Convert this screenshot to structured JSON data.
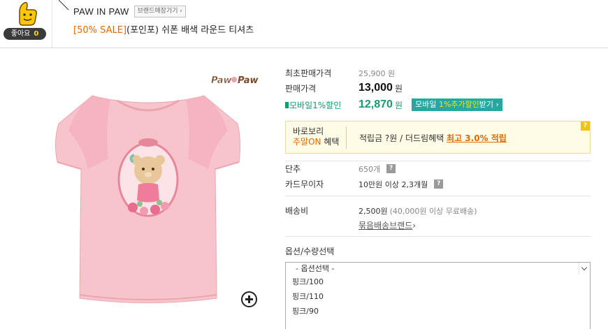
{
  "like": {
    "label": "좋아요",
    "count": "0"
  },
  "brand": {
    "name": "PAW IN PAW",
    "store_button": "브랜드매장가기 ›"
  },
  "product": {
    "sale_tag": "[50% SALE]",
    "title": "(포인포) 쉬폰 배색 라운드 티셔츠",
    "image_brand": "Paw Paw"
  },
  "price": {
    "lowest_label": "최초판매가격",
    "lowest_value": "25,900 원",
    "sale_label": "판매가격",
    "sale_value": "13,000",
    "won": "원",
    "mobile_label": "모바일1%할인",
    "mobile_value": "12,870",
    "mobile_button_prefix": "모바일 ",
    "mobile_button_highlight": "1%추가할인",
    "mobile_button_suffix": "받기 ›"
  },
  "points": {
    "line1": "바로보리",
    "line2_highlight": "주말ON",
    "line2_suffix": " 혜택",
    "desc": "적립금 ?원 / 더드림혜택 ",
    "max": "최고 3.0% 적립"
  },
  "details": {
    "button_label": "단추",
    "button_value": "650개",
    "card_label": "카드무이자",
    "card_value": "10만원 이상 2,3개월",
    "shipping_label": "배송비",
    "shipping_value": "2,500원",
    "shipping_note": "(40,000원 이상 무료배송)",
    "bundle_link": "묶음배송브랜드",
    "bundle_arrow": " ›"
  },
  "options": {
    "title": "옵션/수량선택",
    "selected": "- 옵션선택 -",
    "items": [
      "핑크/100",
      "핑크/110",
      "핑크/90"
    ]
  },
  "colors": {
    "accent_orange": "#e36a00",
    "mobile_green": "#1a9a6c",
    "mobile_btn": "#27a7a0",
    "shirt_pink": "#f8c4cb"
  }
}
